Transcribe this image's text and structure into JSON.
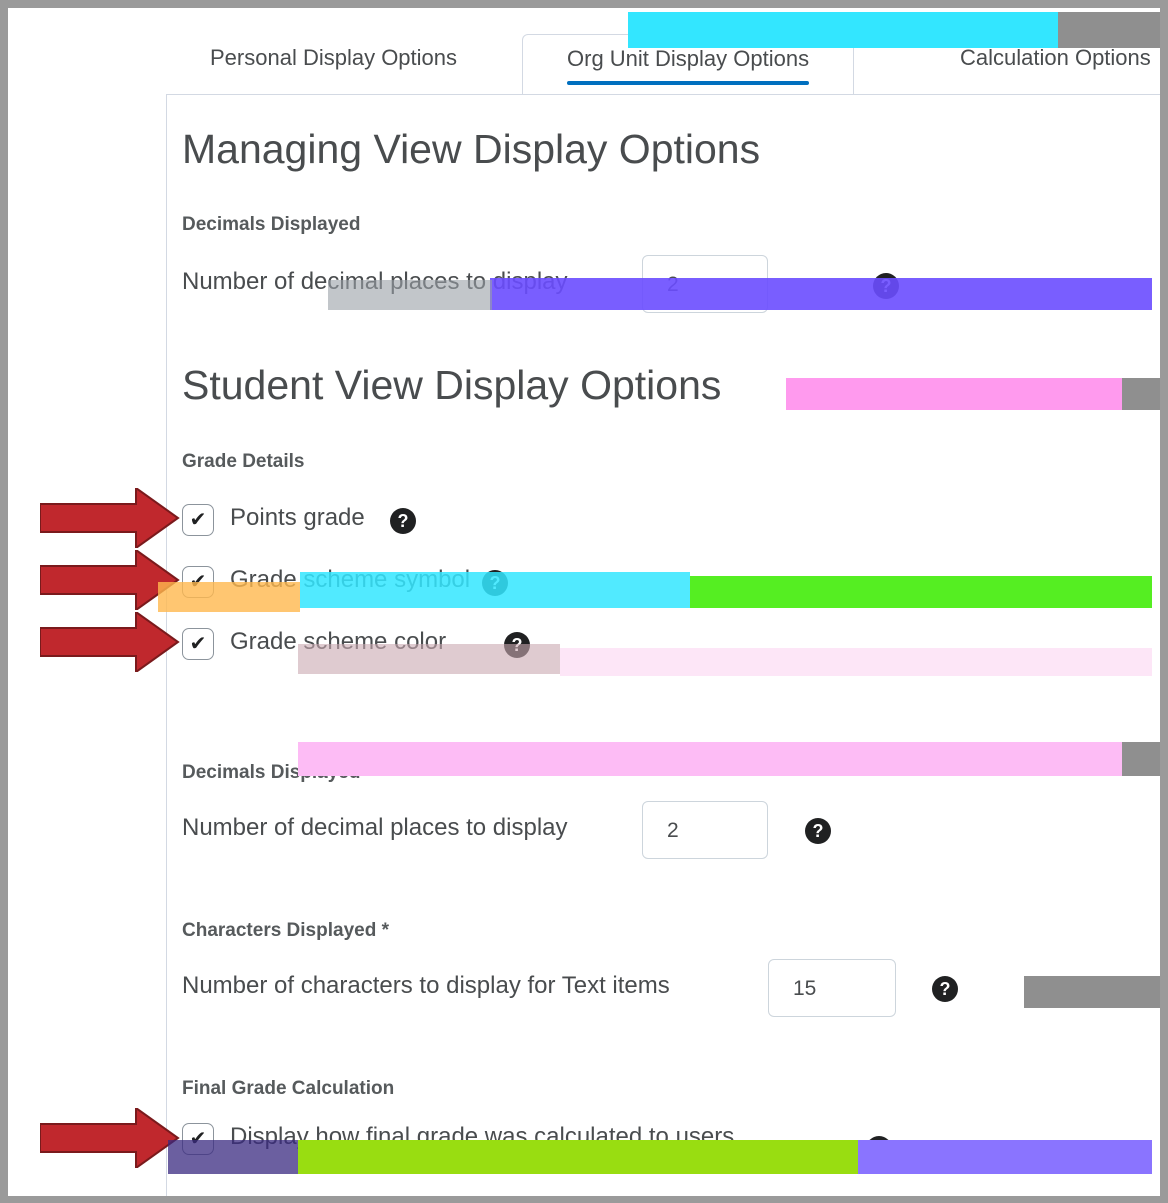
{
  "tabs": [
    {
      "label": "Personal Display Options",
      "active": false
    },
    {
      "label": "Org Unit Display Options",
      "active": true
    },
    {
      "label": "Calculation Options",
      "active": false
    }
  ],
  "managing": {
    "title": "Managing View Display Options",
    "decimals_label": "Decimals Displayed",
    "decimal_places_label": "Number of decimal places to display",
    "decimal_places_value": "2"
  },
  "student": {
    "title": "Student View Display Options",
    "grade_details_label": "Grade Details",
    "options": [
      {
        "label": "Points grade",
        "checked": true
      },
      {
        "label": "Grade scheme symbol",
        "checked": true
      },
      {
        "label": "Grade scheme color",
        "checked": true
      }
    ],
    "decimals_label": "Decimals Displayed",
    "decimal_places_label": "Number of decimal places to display",
    "decimal_places_value": "2",
    "characters_label": "Characters Displayed *",
    "characters_row_label": "Number of characters to display for Text items",
    "characters_value": "15",
    "final_grade_label": "Final Grade Calculation",
    "final_grade_option": {
      "label": "Display how final grade was calculated to users",
      "checked": true
    }
  },
  "icons": {
    "help": "question-circle-icon",
    "check": "checkmark-icon",
    "arrow": "red-arrow-icon"
  },
  "colors": {
    "accent": "#006fbf",
    "arrow": "#c0282d",
    "text": "#494c4e"
  }
}
